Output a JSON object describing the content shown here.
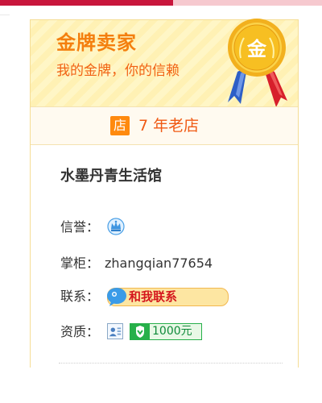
{
  "gold_seller": {
    "title": "金牌卖家",
    "subtitle": "我的金牌，你的信赖",
    "medal_glyph": "金",
    "accent": "#f47f0e"
  },
  "shop_age": {
    "icon_glyph": "店",
    "text": "7 年老店"
  },
  "shop": {
    "name": "水墨丹青生活馆",
    "credit_label": "信誉：",
    "credit_icon": "blue-crown-icon",
    "keeper_label": "掌柜：",
    "keeper_value": "zhangqian77654",
    "contact_label": "联系：",
    "contact_button": "和我联系",
    "qualification_label": "资质：",
    "deposit_text": "1000元"
  },
  "colors": {
    "top_red": "#c8163c",
    "top_pink": "#f6c9cf",
    "gold_text": "#f47f0e",
    "contact_red": "#d5171d",
    "deposit_green": "#27b04a"
  }
}
